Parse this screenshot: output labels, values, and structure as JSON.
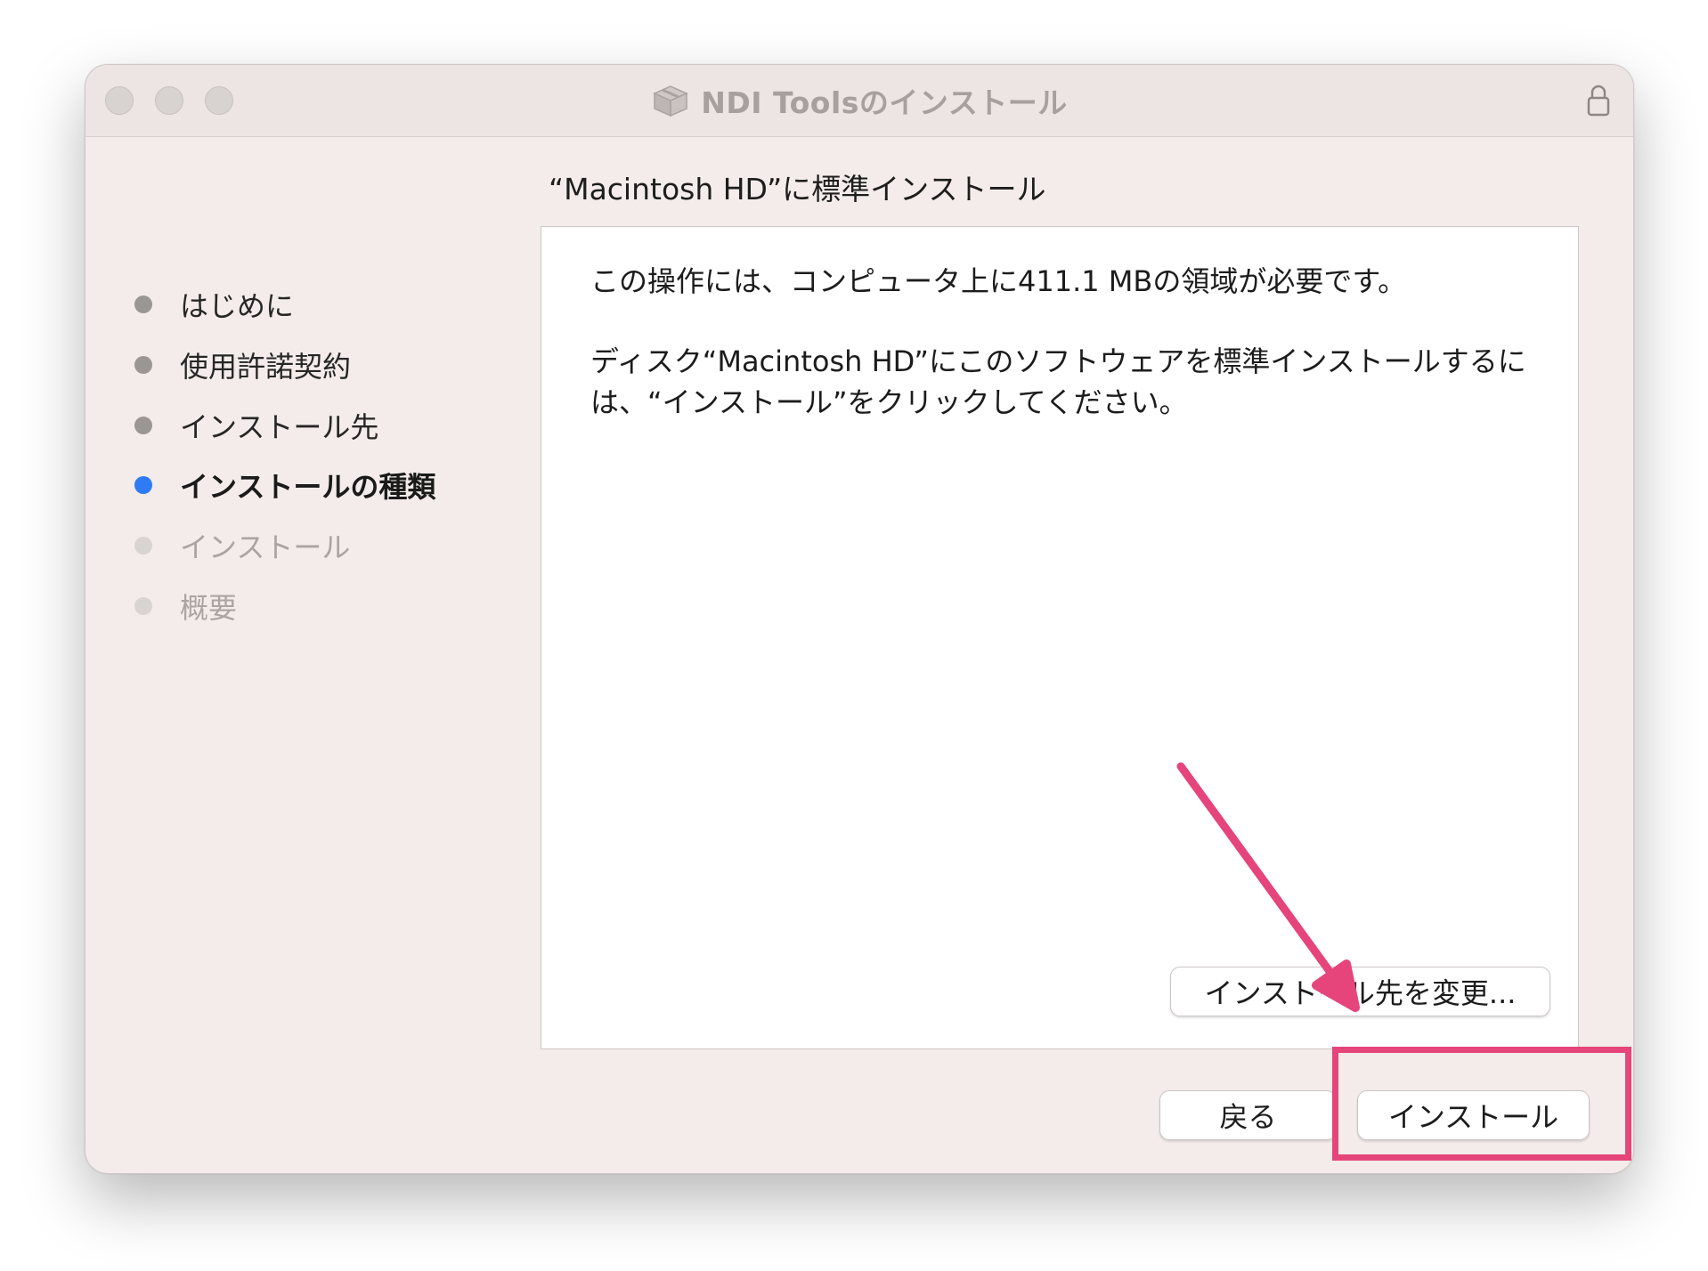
{
  "window": {
    "title": "NDI Toolsのインストール"
  },
  "page": {
    "title": "“Macintosh HD”に標準インストール"
  },
  "sidebar": {
    "steps": [
      {
        "label": "はじめに",
        "state": "done"
      },
      {
        "label": "使用許諾契約",
        "state": "done"
      },
      {
        "label": "インストール先",
        "state": "done"
      },
      {
        "label": "インストールの種類",
        "state": "current"
      },
      {
        "label": "インストール",
        "state": "future"
      },
      {
        "label": "概要",
        "state": "future"
      }
    ]
  },
  "content": {
    "message_1": "この操作には、コンピュータ上に411.1 MBの領域が必要です。",
    "message_2": "ディスク“Macintosh HD”にこのソフトウェアを標準インストールするには、“インストール”をクリックしてください。",
    "change_location_label": "インストール先を変更..."
  },
  "footer": {
    "back_label": "戻る",
    "install_label": "インストール"
  },
  "colors": {
    "window_bg": "#f3ecea",
    "current_step_dot": "#2f7bf5",
    "annotation": "#e5457a"
  },
  "icons": {
    "title": "package-icon",
    "lock": "lock-icon"
  }
}
